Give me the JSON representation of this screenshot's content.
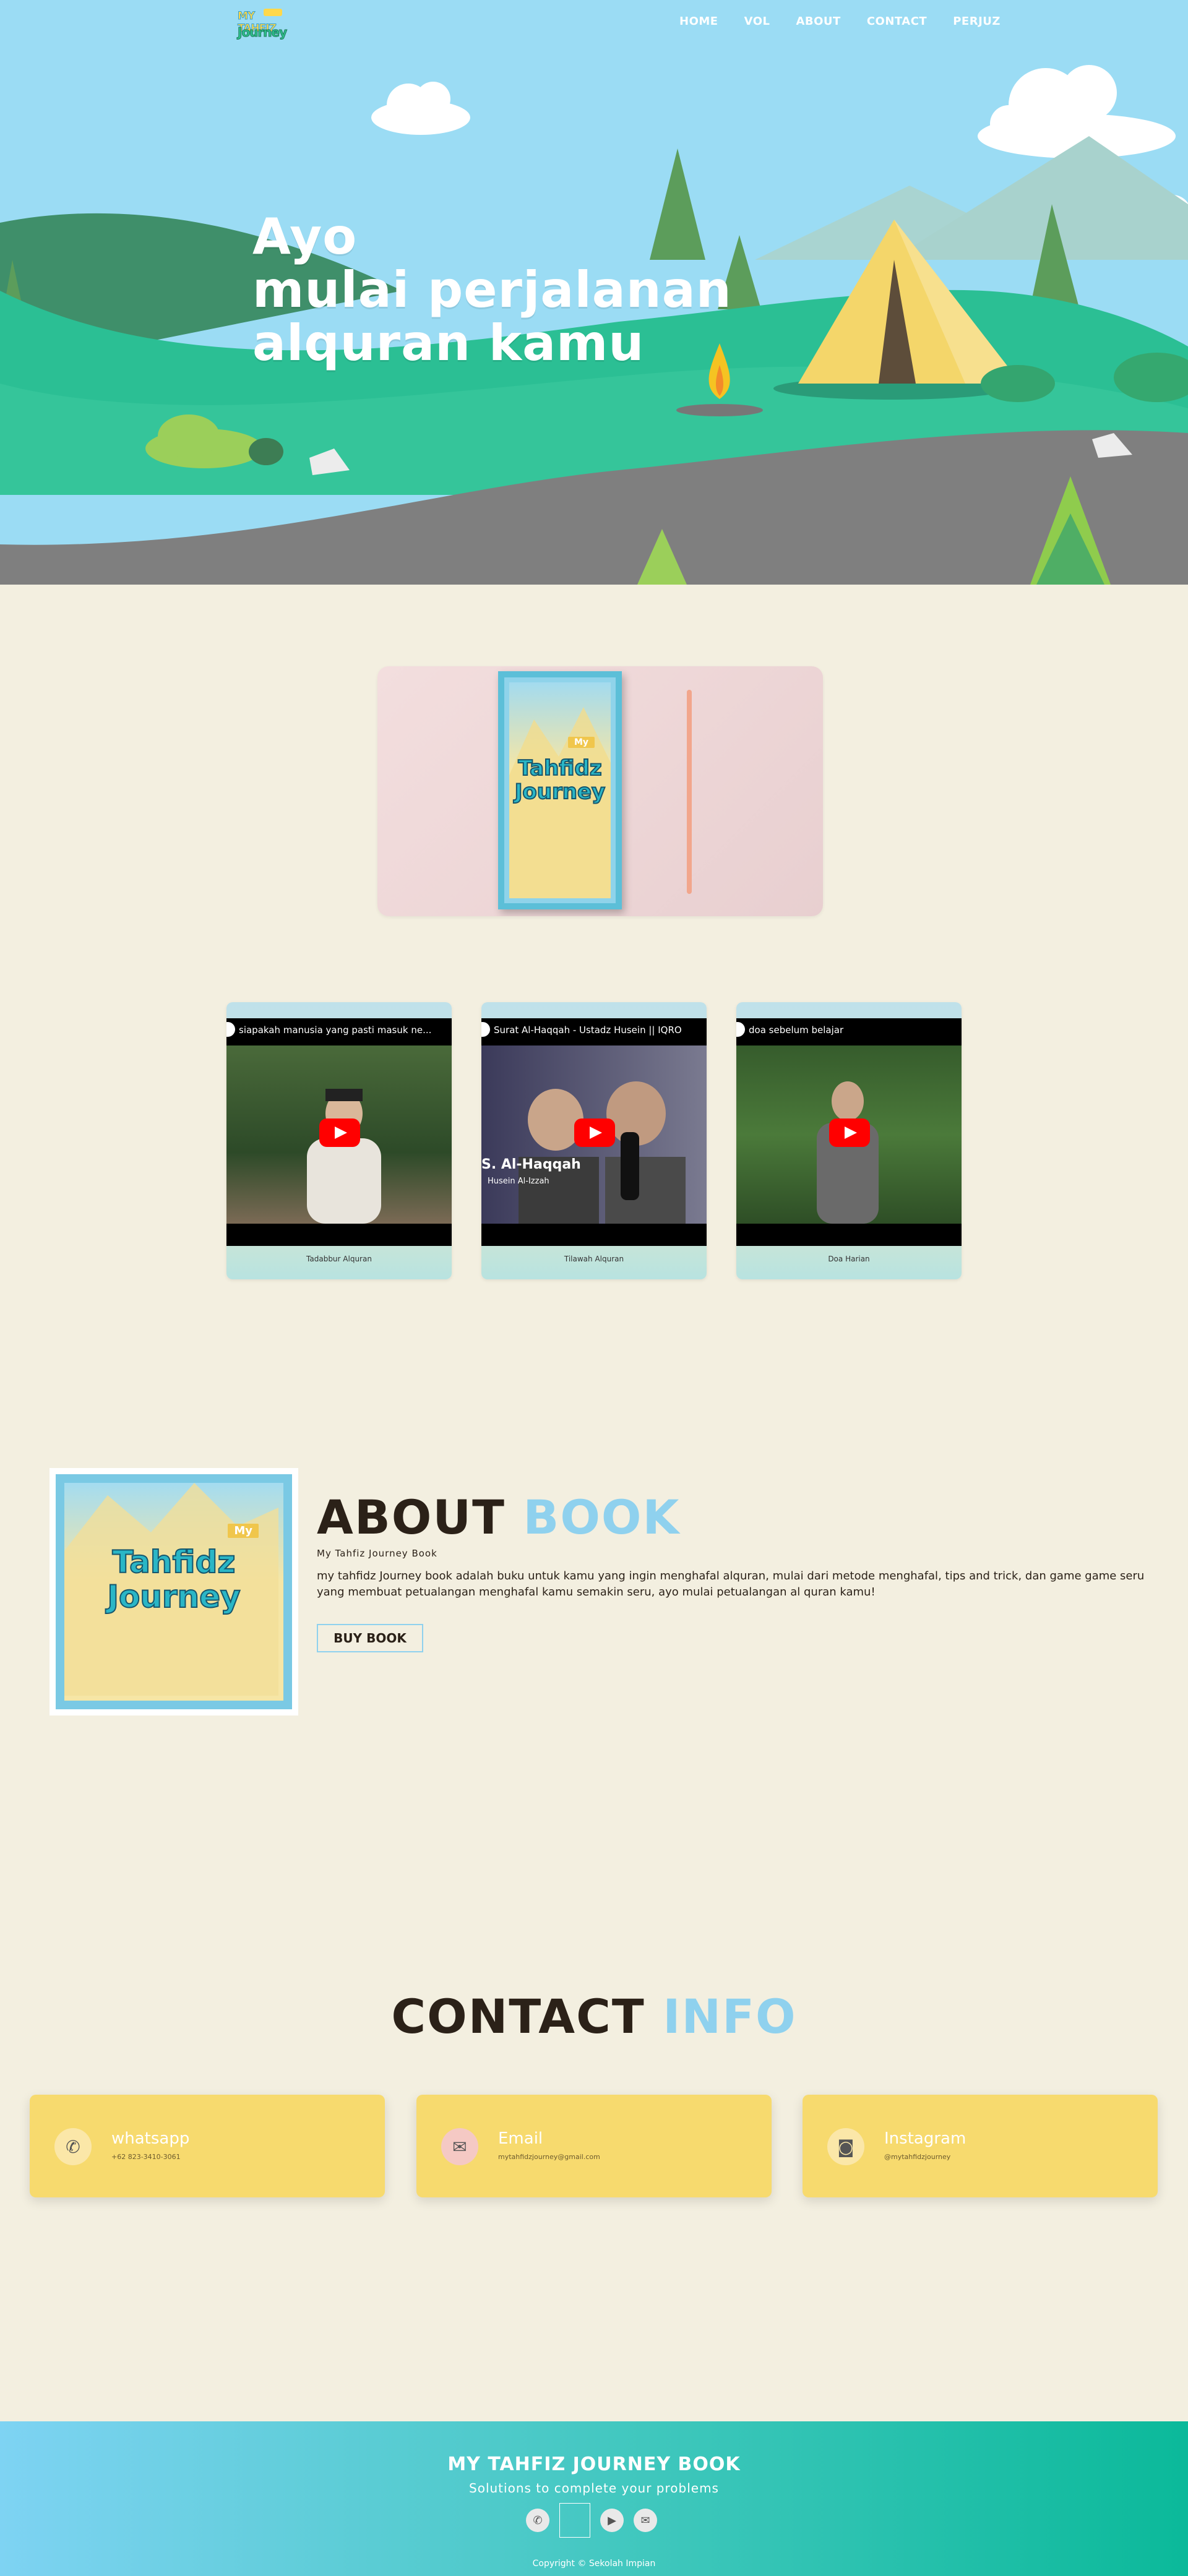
{
  "logo": {
    "line1": "MY TAHFIZ",
    "line2": "Journey"
  },
  "nav": {
    "items": [
      "HOME",
      "VOL",
      "ABOUT",
      "CONTACT",
      "PERJUZ"
    ]
  },
  "hero": {
    "lines": [
      "Ayo",
      "mulai perjalanan",
      "alquran kamu"
    ]
  },
  "book": {
    "my": "My",
    "title_line1": "Tahfidz",
    "title_line2": "Journey"
  },
  "videos": [
    {
      "title": "siapakah manusia yang pasti masuk ne...",
      "caption": "Tadabbur Alquran"
    },
    {
      "title": "Surat Al-Haqqah - Ustadz Husein || IQRO",
      "caption": "Tilawah Alquran",
      "overlay": "S. Al-Haqqah",
      "overlay_sub": "Husein Al-Izzah"
    },
    {
      "title": "doa sebelum belajar",
      "caption": "Doa Harian"
    }
  ],
  "about": {
    "title_a": "ABOUT",
    "title_b": "BOOK",
    "subtitle": "My Tahfiz Journey Book",
    "description": "my tahfidz Journey book adalah buku untuk kamu yang ingin menghafal alquran, mulai dari metode menghafal, tips and trick, dan game game seru yang membuat petualangan menghafal kamu semakin seru, ayo mulai petualangan al quran kamu!",
    "button": "BUY BOOK"
  },
  "contact": {
    "title_a": "CONTACT",
    "title_b": "INFO",
    "cards": [
      {
        "title": "whatsapp",
        "sub": "+62 823-3410-3061",
        "icon": "whatsapp-icon"
      },
      {
        "title": "Email",
        "sub": "mytahfidzjourney@gmail.com",
        "icon": "email-icon"
      },
      {
        "title": "Instagram",
        "sub": "@mytahfidzjourney",
        "icon": "instagram-icon"
      }
    ]
  },
  "footer": {
    "title": "MY TAHFIZ JOURNEY BOOK",
    "subtitle": "Solutions to complete your problems",
    "copyright": "Copyright © Sekolah Impian"
  },
  "colors": {
    "sky": "#9bdcf4",
    "accent": "#8fd1ee",
    "card": "#f7da6e",
    "bg": "#f3efe0"
  }
}
